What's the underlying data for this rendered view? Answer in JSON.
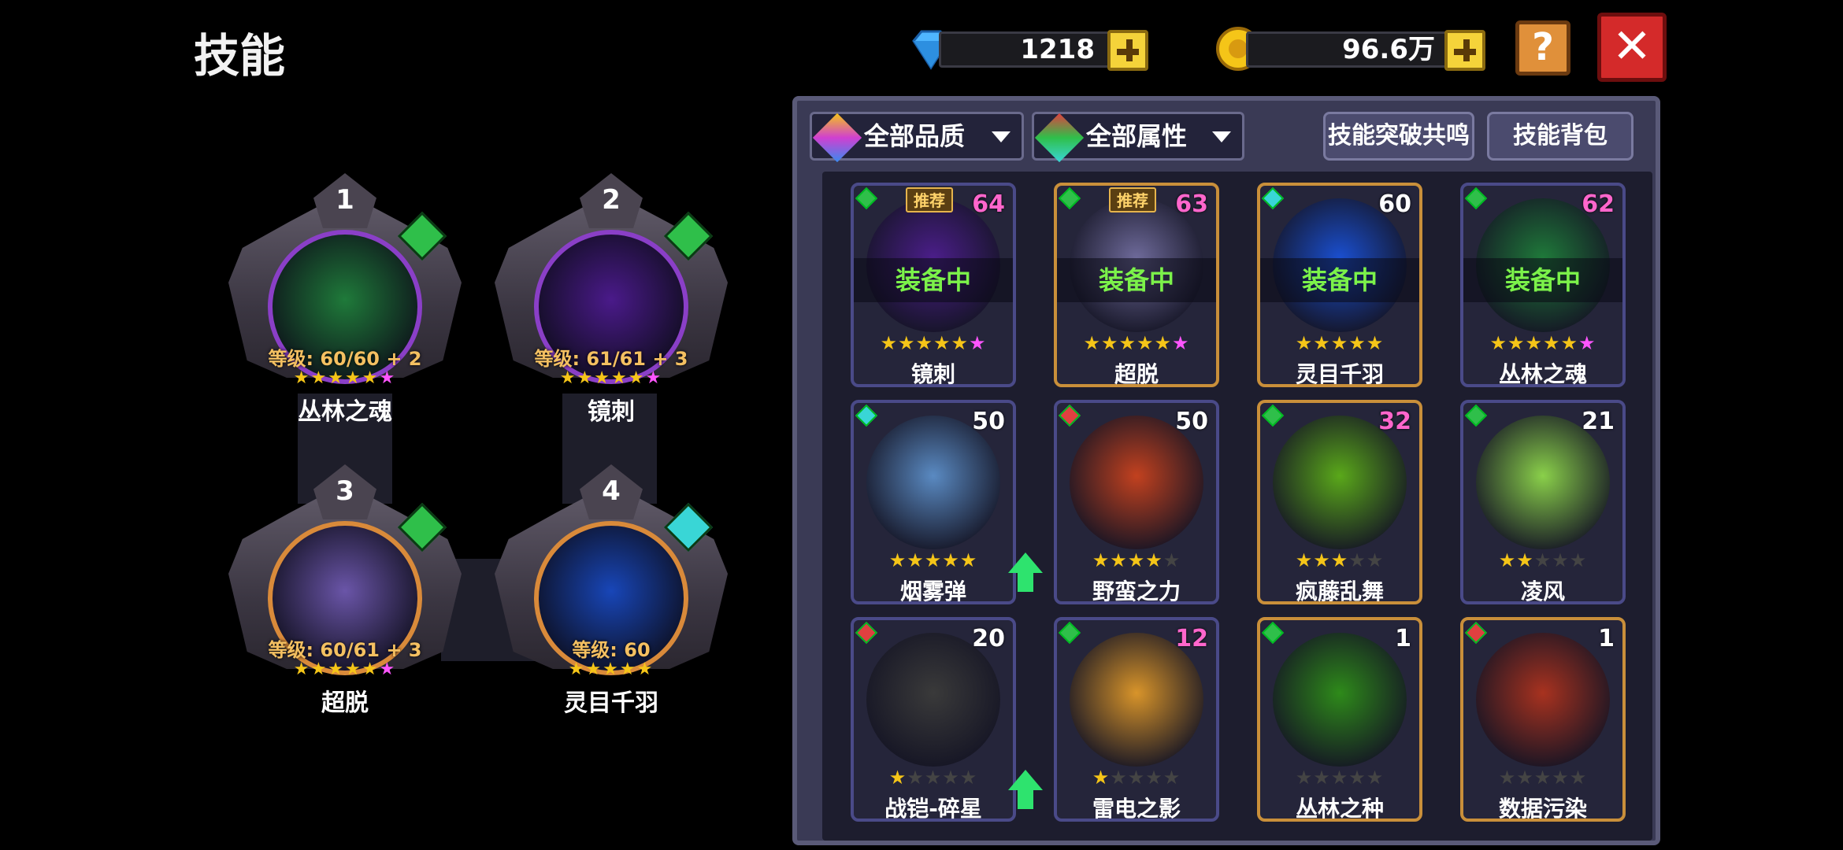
{
  "header": {
    "title": "技能",
    "gems": "1218",
    "coins": "96.6万",
    "help_label": "?",
    "close_label": "✕"
  },
  "slots": [
    {
      "num": "1",
      "level": "等级: 60/60 + 2",
      "name": "丛林之魂",
      "stars": "★★★★★★",
      "orb": "#1f7a3a",
      "ring": "#8a3fc7",
      "gem": "#2fbf4a"
    },
    {
      "num": "2",
      "level": "等级: 61/61 + 3",
      "name": "镜刺",
      "stars": "★★★★★★",
      "orb": "#4a1a8a",
      "ring": "#8a3fc7",
      "gem": "#2fbf4a"
    },
    {
      "num": "3",
      "level": "等级: 60/61 + 3",
      "name": "超脱",
      "stars": "★★★★★★",
      "orb": "#6a55a8",
      "ring": "#d98a3a",
      "gem": "#2fbf4a"
    },
    {
      "num": "4",
      "level": "等级: 60",
      "name": "灵目千羽",
      "stars": "★★★★★",
      "orb": "#1846b8",
      "ring": "#d98a3a",
      "gem": "#39d6d6"
    }
  ],
  "filters": {
    "quality": "全部品质",
    "attribute": "全部属性",
    "resonance": "技能突破共鸣",
    "bag": "技能背包"
  },
  "cards": [
    {
      "name": "镜刺",
      "count": "64",
      "count_pink": true,
      "rec": "推荐",
      "equip": "装备中",
      "stars_full": 5,
      "stars_pink": 1,
      "stars_empty": 0,
      "gold": false,
      "art": "#4b1e8a",
      "attr": "#2fbf4a"
    },
    {
      "name": "超脱",
      "count": "63",
      "count_pink": true,
      "rec": "推荐",
      "equip": "装备中",
      "stars_full": 5,
      "stars_pink": 1,
      "stars_empty": 0,
      "gold": true,
      "art": "#6e6a9a",
      "attr": "#2fbf4a"
    },
    {
      "name": "灵目千羽",
      "count": "60",
      "count_pink": false,
      "rec": "",
      "equip": "装备中",
      "stars_full": 5,
      "stars_pink": 0,
      "stars_empty": 0,
      "gold": true,
      "art": "#1a4fd0",
      "attr": "#39d6d6"
    },
    {
      "name": "丛林之魂",
      "count": "62",
      "count_pink": true,
      "rec": "",
      "equip": "装备中",
      "stars_full": 5,
      "stars_pink": 1,
      "stars_empty": 0,
      "gold": false,
      "art": "#1f7a3a",
      "attr": "#2fbf4a"
    },
    {
      "name": "烟雾弹",
      "count": "50",
      "count_pink": false,
      "rec": "",
      "equip": "",
      "stars_full": 5,
      "stars_pink": 0,
      "stars_empty": 0,
      "gold": false,
      "art": "#5a8ac2",
      "attr": "#39d6d6"
    },
    {
      "name": "野蛮之力",
      "count": "50",
      "count_pink": false,
      "rec": "",
      "equip": "",
      "stars_full": 4,
      "stars_pink": 0,
      "stars_empty": 1,
      "gold": false,
      "art": "#c2411f",
      "attr": "#e04040",
      "upgrade": true
    },
    {
      "name": "疯藤乱舞",
      "count": "32",
      "count_pink": true,
      "rec": "",
      "equip": "",
      "stars_full": 3,
      "stars_pink": 0,
      "stars_empty": 2,
      "gold": true,
      "art": "#5aa81a",
      "attr": "#2fbf4a"
    },
    {
      "name": "凌风",
      "count": "21",
      "count_pink": false,
      "rec": "",
      "equip": "",
      "stars_full": 2,
      "stars_pink": 0,
      "stars_empty": 3,
      "gold": false,
      "art": "#8ad04a",
      "attr": "#2fbf4a"
    },
    {
      "name": "战铠-碎星",
      "count": "20",
      "count_pink": false,
      "rec": "",
      "equip": "",
      "stars_full": 1,
      "stars_pink": 0,
      "stars_empty": 4,
      "gold": false,
      "art": "#3a3a3a",
      "attr": "#e04040"
    },
    {
      "name": "雷电之影",
      "count": "12",
      "count_pink": true,
      "rec": "",
      "equip": "",
      "stars_full": 1,
      "stars_pink": 0,
      "stars_empty": 4,
      "gold": false,
      "art": "#d8942a",
      "attr": "#2fbf4a",
      "upgrade": true
    },
    {
      "name": "丛林之种",
      "count": "1",
      "count_pink": false,
      "rec": "",
      "equip": "",
      "stars_full": 0,
      "stars_pink": 0,
      "stars_empty": 5,
      "gold": true,
      "art": "#2e8a1a",
      "attr": "#2fbf4a"
    },
    {
      "name": "数据污染",
      "count": "1",
      "count_pink": false,
      "rec": "",
      "equip": "",
      "stars_full": 0,
      "stars_pink": 0,
      "stars_empty": 5,
      "gold": true,
      "art": "#a8321f",
      "attr": "#e04040"
    }
  ]
}
